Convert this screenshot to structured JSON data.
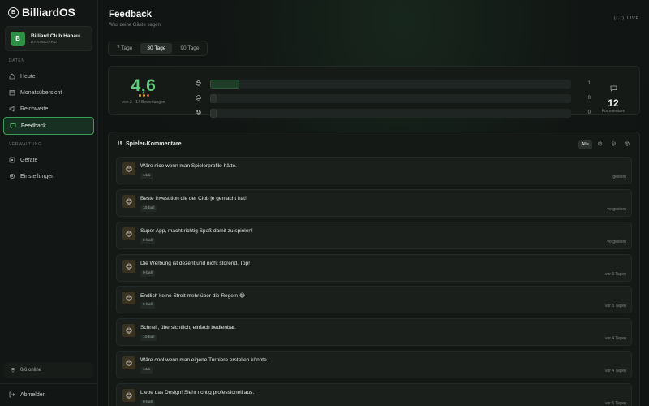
{
  "brand": {
    "name": "BilliardOS",
    "logo": "B"
  },
  "club": {
    "initial": "B",
    "name": "Billiard Club Hanau",
    "sub": "DASHBOARD"
  },
  "nav": {
    "section_daten": "DATEN",
    "items_daten": [
      {
        "label": "Heute",
        "icon": "home-icon"
      },
      {
        "label": "Monatsübersicht",
        "icon": "calendar-icon"
      },
      {
        "label": "Reichweite",
        "icon": "megaphone-icon"
      },
      {
        "label": "Feedback",
        "icon": "message-icon",
        "active": true
      }
    ],
    "section_verwaltung": "VERWALTUNG",
    "items_verwaltung": [
      {
        "label": "Geräte",
        "icon": "device-icon"
      },
      {
        "label": "Einstellungen",
        "icon": "gear-icon"
      }
    ],
    "online": "0/6 online",
    "logout": "Abmelden"
  },
  "header": {
    "title": "Feedback",
    "subtitle": "Was deine Gäste sagen",
    "live": "LIVE"
  },
  "tabs": [
    {
      "label": "7 Tage"
    },
    {
      "label": "30 Tage",
      "active": true
    },
    {
      "label": "90 Tage"
    }
  ],
  "summary": {
    "score": "4,6",
    "meta": "von 3 · 17 Bewertungen",
    "bars": [
      {
        "emoji": "😊",
        "count": "1",
        "fill": 0.08
      },
      {
        "emoji": "😐",
        "count": "0",
        "fill": 0
      },
      {
        "emoji": "😞",
        "count": "0",
        "fill": 0
      }
    ],
    "comment_count": "12",
    "comment_label": "Kommentare"
  },
  "comments": {
    "title": "Spieler-Kommentare",
    "filters": [
      {
        "label": "Alle",
        "active": true
      },
      {
        "label": "😊"
      },
      {
        "label": "😐"
      },
      {
        "label": "😞"
      }
    ],
    "items": [
      {
        "emoji": "😊",
        "text": "Wäre nice wenn man Spielerprofile hätte.",
        "tag": "14/1",
        "time": "gestern"
      },
      {
        "emoji": "😊",
        "text": "Beste Investition die der Club je gemacht hat!",
        "tag": "10-ball",
        "time": "vorgestern"
      },
      {
        "emoji": "😊",
        "text": "Super App, macht richtig Spaß damit zu spielen!",
        "tag": "8-ball",
        "time": "vorgestern"
      },
      {
        "emoji": "😊",
        "text": "Die Werbung ist dezent und nicht störend. Top!",
        "tag": "9-ball",
        "time": "vor 3 Tagen"
      },
      {
        "emoji": "😊",
        "text": "Endlich keine Streit mehr über die Regeln 😂",
        "tag": "9-ball",
        "time": "vor 3 Tagen"
      },
      {
        "emoji": "😊",
        "text": "Schnell, übersichtlich, einfach bedienbar.",
        "tag": "10-ball",
        "time": "vor 4 Tagen"
      },
      {
        "emoji": "😊",
        "text": "Wäre cool wenn man eigene Turniere erstellen könnte.",
        "tag": "14/1",
        "time": "vor 4 Tagen"
      },
      {
        "emoji": "😊",
        "text": "Liebe das Design! Sieht richtig professionell aus.",
        "tag": "8-ball",
        "time": "vor 5 Tagen"
      }
    ]
  }
}
